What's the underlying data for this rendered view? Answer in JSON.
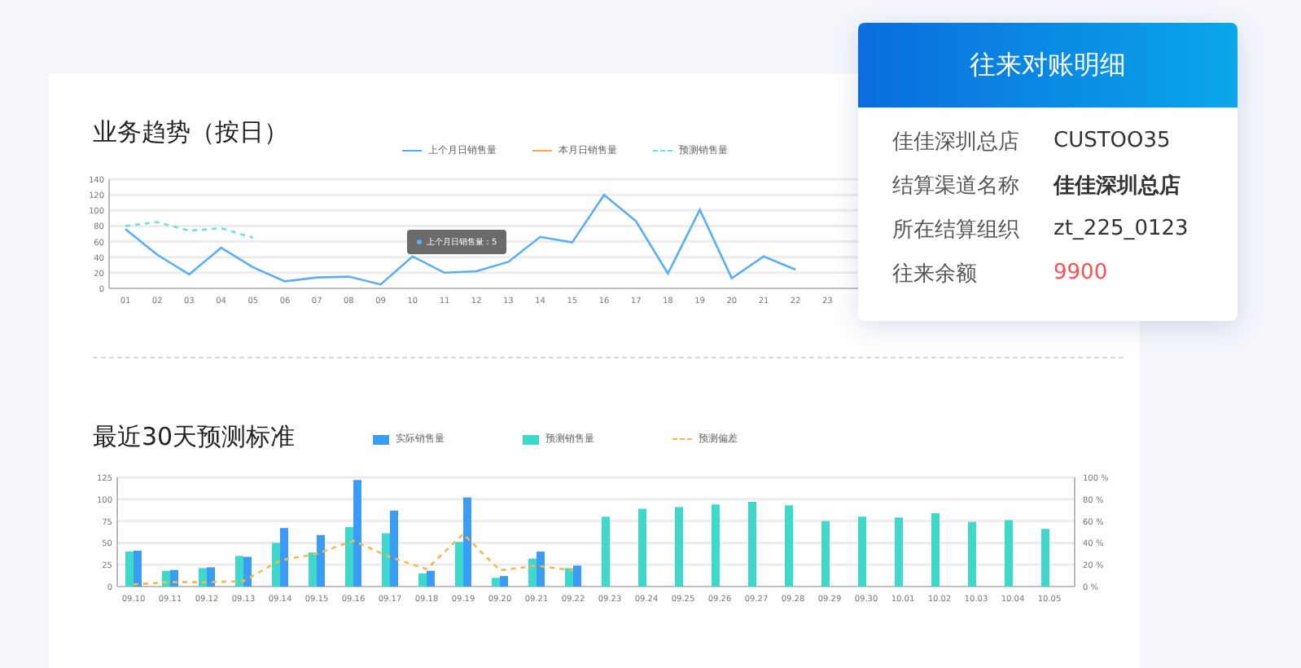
{
  "trend": {
    "title": "业务趋势（按日）",
    "chart_data": {
      "type": "line",
      "legend": "top",
      "grid": true,
      "categories": [
        "01",
        "02",
        "03",
        "04",
        "05",
        "06",
        "07",
        "08",
        "09",
        "10",
        "11",
        "12",
        "13",
        "14",
        "15",
        "16",
        "17",
        "18",
        "19",
        "20",
        "21",
        "22",
        "23"
      ],
      "series": [
        {
          "name": "上个月日销售量",
          "color": "#5aaef5",
          "line_style": "solid",
          "values": [
            76,
            43,
            18,
            52,
            27,
            9,
            14,
            15,
            5,
            41,
            20,
            22,
            34,
            66,
            59,
            120,
            86,
            19,
            101,
            13,
            41,
            24,
            null
          ]
        },
        {
          "name": "本月日销售量",
          "color": "#f5a55a",
          "line_style": "solid",
          "values": [
            null,
            null,
            null,
            null,
            null,
            null,
            null,
            null,
            null,
            null,
            null,
            null,
            null,
            null,
            null,
            null,
            null,
            null,
            null,
            null,
            null,
            null,
            null
          ]
        },
        {
          "name": "预测销售量",
          "color": "#6ee0d8",
          "line_style": "dashed",
          "values": [
            80,
            85,
            74,
            77,
            65,
            null,
            null,
            null,
            null,
            null,
            null,
            null,
            null,
            null,
            null,
            null,
            null,
            null,
            null,
            null,
            null,
            null,
            null
          ]
        }
      ],
      "ylim": [
        0,
        140
      ],
      "yticks": [
        0,
        20,
        40,
        60,
        80,
        100,
        120,
        140
      ],
      "annotations": [
        "上个月日销售量：5"
      ]
    }
  },
  "forecast": {
    "title": "最近30天预测标准",
    "chart_data": {
      "type": "bar",
      "legend": "top",
      "grid": true,
      "stacked": false,
      "categories": [
        "09.10",
        "09.11",
        "09.12",
        "09.13",
        "09.14",
        "09.15",
        "09.16",
        "09.17",
        "09.18",
        "09.19",
        "09.20",
        "09.21",
        "09.22",
        "09.23",
        "09.24",
        "09.25",
        "09.26",
        "09.27",
        "09.28",
        "09.29",
        "09.30",
        "10.01",
        "10.02",
        "10.03",
        "10.04",
        "10.05"
      ],
      "series": [
        {
          "name": "实际销售量",
          "color": "#3a9cf6",
          "values": [
            41,
            19,
            22,
            34,
            67,
            59,
            122,
            87,
            18,
            102,
            12,
            40,
            24,
            null,
            null,
            null,
            null,
            null,
            null,
            null,
            null,
            null,
            null,
            null,
            null,
            null
          ]
        },
        {
          "name": "预测销售量",
          "color": "#3ed8cc",
          "values": [
            40,
            18,
            21,
            35,
            50,
            39,
            68,
            61,
            15,
            51,
            10,
            32,
            21,
            80,
            89,
            91,
            94,
            97,
            93,
            75,
            80,
            79,
            84,
            74,
            76,
            66
          ]
        },
        {
          "name": "预测偏差",
          "type": "line",
          "axis": "y2",
          "line_style": "dashed",
          "color": "#f7b84a",
          "values": [
            2,
            4,
            4,
            5,
            24,
            30,
            42,
            27,
            16,
            48,
            15,
            19,
            15,
            null,
            null,
            null,
            null,
            null,
            null,
            null,
            null,
            null,
            null,
            null,
            null,
            null
          ]
        }
      ],
      "ylim": [
        0,
        125
      ],
      "yticks": [
        0,
        25,
        50,
        75,
        100,
        125
      ],
      "y2lim": [
        0,
        100
      ],
      "y2ticks": [
        {
          "value": 0,
          "label": "0 %"
        },
        {
          "value": 20,
          "label": "20 %"
        },
        {
          "value": 40,
          "label": "40 %"
        },
        {
          "value": 60,
          "label": "60 %"
        },
        {
          "value": 80,
          "label": "80 %"
        },
        {
          "value": 100,
          "label": "100 %"
        }
      ]
    }
  },
  "detail_card": {
    "title": "往来对账明细",
    "rows": [
      {
        "label": "佳佳深圳总店",
        "value": "CUSTOO35",
        "bold": false,
        "color": "#333333"
      },
      {
        "label": "结算渠道名称",
        "value": "佳佳深圳总店",
        "bold": true,
        "color": "#333333"
      },
      {
        "label": "所在结算组织",
        "value": "zt_225_0123",
        "bold": false,
        "color": "#333333"
      },
      {
        "label": "往来余额",
        "value": "9900",
        "bold": false,
        "color": "#ff4d4f"
      }
    ]
  }
}
